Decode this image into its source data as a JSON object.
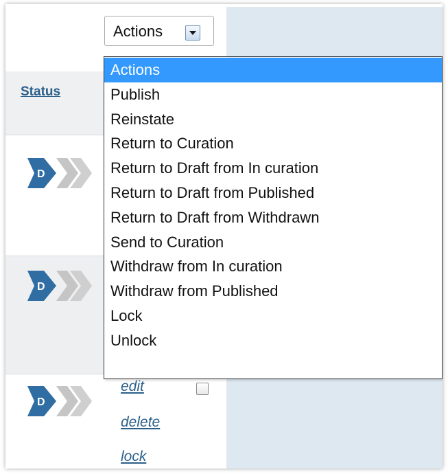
{
  "table": {
    "status_header": "Status",
    "rows": [
      {
        "status_badge": "D",
        "links": []
      },
      {
        "status_badge": "D",
        "links": []
      },
      {
        "status_badge": "D",
        "links": [
          "edit",
          "delete",
          "lock"
        ]
      }
    ]
  },
  "actions_select": {
    "selected_value": "Actions",
    "options": [
      "Actions",
      "Publish",
      "Reinstate",
      "Return to Curation",
      "Return to Draft from In curation",
      "Return to Draft from Published",
      "Return to Draft from Withdrawn",
      "Send to Curation",
      "Withdraw from In curation",
      "Withdraw from Published",
      "Lock",
      "Unlock"
    ],
    "highlighted_option": "Actions"
  },
  "colors": {
    "highlight": "#3399ff",
    "link": "#2a5f8a",
    "panel_background": "#dee8f1",
    "status_chevron_active": "#2f6da3",
    "status_chevron_inactive": "#c5c5c5"
  },
  "icons": {
    "status": "workflow-draft-chevrons-icon",
    "select_arrow": "chevron-down-icon"
  }
}
